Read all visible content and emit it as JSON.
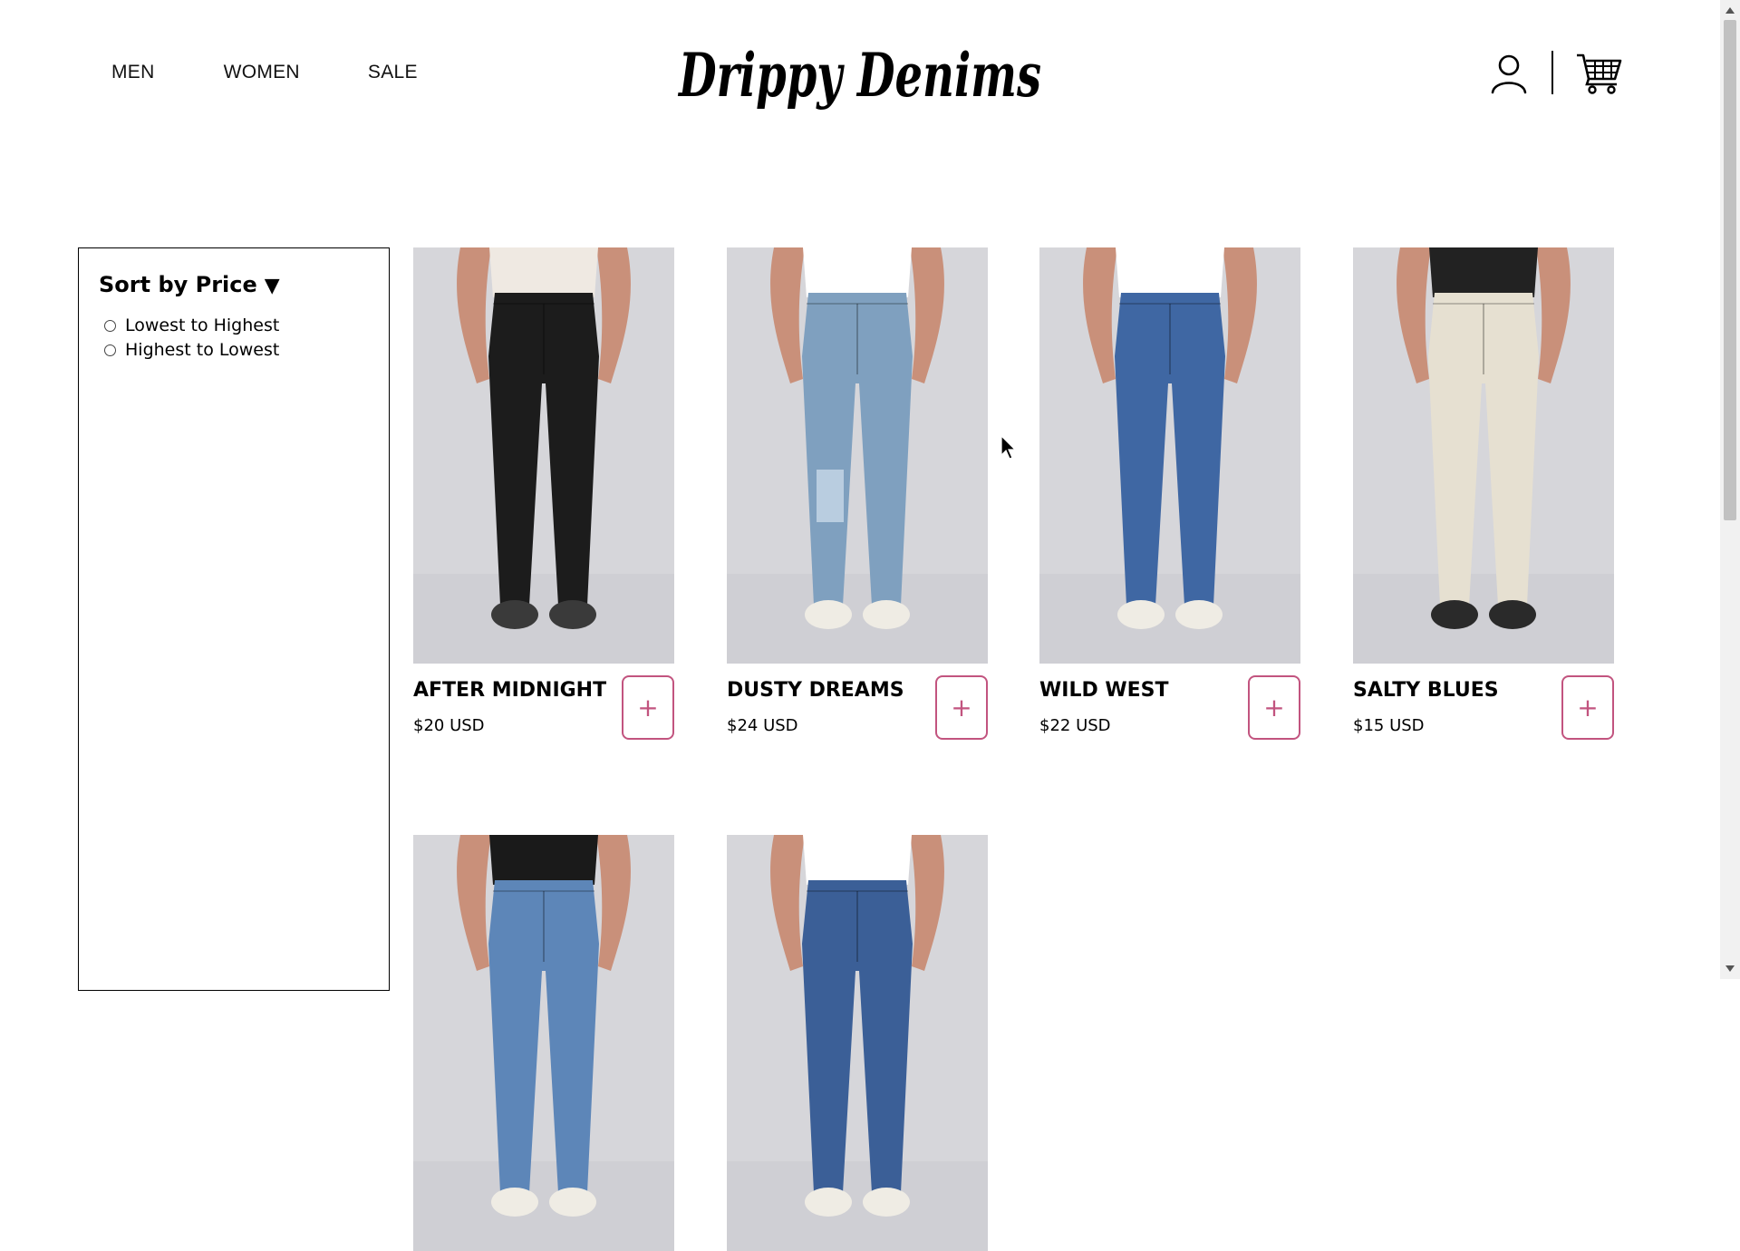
{
  "nav": {
    "men": "MEN",
    "women": "WOMEN",
    "sale": "SALE"
  },
  "brand": {
    "logo_text": "Drippy Denims"
  },
  "header": {
    "account_icon": "user-icon",
    "cart_icon": "cart-icon"
  },
  "sort": {
    "title": "Sort by Price",
    "arrow": "▼",
    "options": [
      "Lowest to Highest",
      "Highest to Lowest"
    ]
  },
  "products": [
    {
      "name": "AFTER MIDNIGHT",
      "price": "$20 USD",
      "add_label": "+",
      "denim_color": "#1c1c1c"
    },
    {
      "name": "DUSTY DREAMS",
      "price": "$24 USD",
      "add_label": "+",
      "denim_color": "#7fa0bf"
    },
    {
      "name": "WILD WEST",
      "price": "$22 USD",
      "add_label": "+",
      "denim_color": "#3f67a3"
    },
    {
      "name": "SALTY BLUES",
      "price": "$15 USD",
      "add_label": "+",
      "denim_color": "#e6e0d1"
    },
    {
      "denim_color": "#5d86b8"
    },
    {
      "denim_color": "#3b5f97"
    }
  ],
  "colors": {
    "accent": "#c2547f",
    "text": "#000000",
    "image_bg": "#d9d9dc"
  }
}
